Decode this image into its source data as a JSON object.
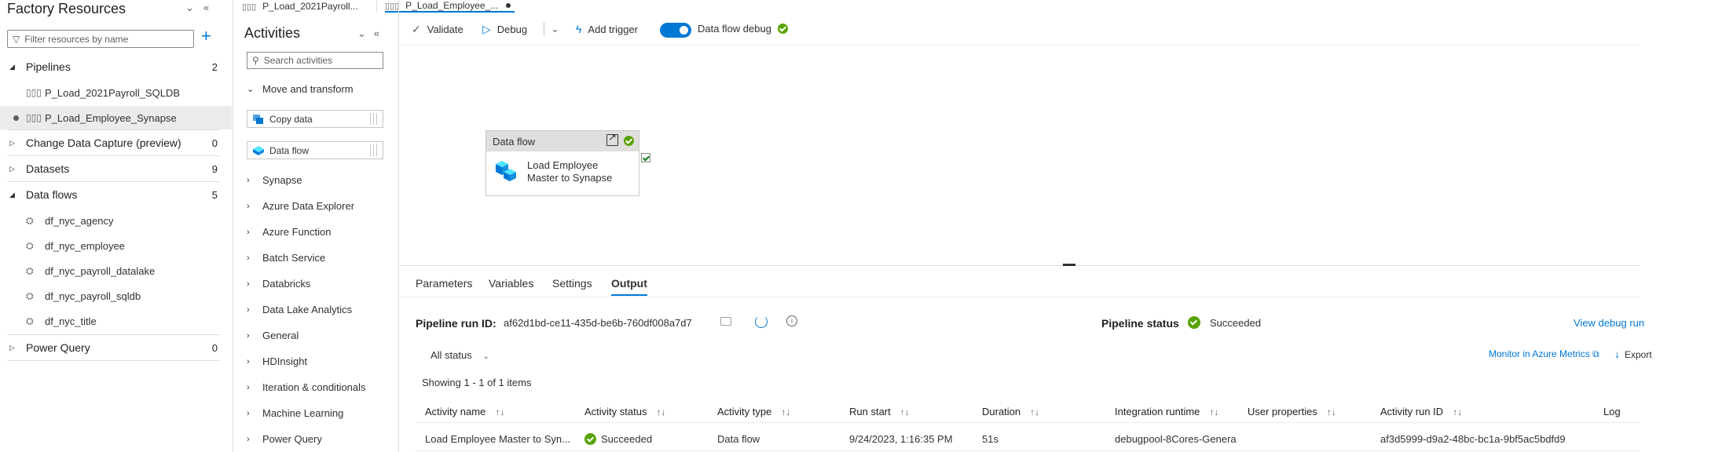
{
  "tabs": [
    {
      "label": "P_Load_2021Payroll..."
    },
    {
      "label": "P_Load_Employee_..."
    }
  ],
  "resources": {
    "title": "Factory Resources",
    "filter_placeholder": "Filter resources by name",
    "categories": {
      "pipelines": {
        "label": "Pipelines",
        "count": "2"
      },
      "cdc": {
        "label": "Change Data Capture (preview)",
        "count": "0"
      },
      "datasets": {
        "label": "Datasets",
        "count": "9"
      },
      "dataflows": {
        "label": "Data flows",
        "count": "5"
      },
      "powerquery": {
        "label": "Power Query",
        "count": "0"
      }
    },
    "pipelines": [
      "P_Load_2021Payroll_SQLDB",
      "P_Load_Employee_Synapse"
    ],
    "dataflows": [
      "df_nyc_agency",
      "df_nyc_employee",
      "df_nyc_payroll_datalake",
      "df_nyc_payroll_sqldb",
      "df_nyc_title"
    ]
  },
  "activities": {
    "title": "Activities",
    "search_placeholder": "Search activities",
    "open_category": "Move and transform",
    "items": [
      "Copy data",
      "Data flow"
    ],
    "categories": [
      "Synapse",
      "Azure Data Explorer",
      "Azure Function",
      "Batch Service",
      "Databricks",
      "Data Lake Analytics",
      "General",
      "HDInsight",
      "Iteration & conditionals",
      "Machine Learning",
      "Power Query"
    ]
  },
  "toolbar": {
    "validate": "Validate",
    "debug": "Debug",
    "add_trigger": "Add trigger",
    "dataflow_debug": "Data flow debug"
  },
  "canvas": {
    "node_type": "Data flow",
    "node_label_line1": "Load Employee",
    "node_label_line2": "Master to Synapse"
  },
  "panel": {
    "tabs": [
      "Parameters",
      "Variables",
      "Settings",
      "Output"
    ],
    "active_tab": "Output",
    "run_id_label": "Pipeline run ID:",
    "run_id": "af62d1bd-ce11-435d-be6b-760df008a7d7",
    "status_label": "Pipeline status",
    "status": "Succeeded",
    "view_debug": "View debug run",
    "filter": "All status",
    "monitor": "Monitor in Azure Metrics",
    "export": "Export",
    "showing": "Showing 1 - 1 of 1 items",
    "columns": [
      "Activity name",
      "Activity status",
      "Activity type",
      "Run start",
      "Duration",
      "Integration runtime",
      "User properties",
      "Activity run ID",
      "Log"
    ],
    "rows": [
      {
        "name": "Load Employee Master to Syn...",
        "status": "Succeeded",
        "type": "Data flow",
        "start": "9/24/2023, 1:16:35 PM",
        "duration": "51s",
        "runtime": "debugpool-8Cores-Genera",
        "user_props": "",
        "run_id": "af3d5999-d9a2-48bc-bc1a-9bf5ac5bdfd9",
        "log": ""
      }
    ]
  },
  "colors": {
    "accent": "#0078d4",
    "success": "#57a300"
  }
}
